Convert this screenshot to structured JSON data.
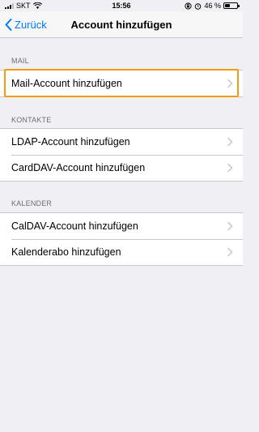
{
  "status_bar": {
    "carrier": "SKT",
    "time": "15:56",
    "battery_percent": "46 %",
    "battery_level": 0.46
  },
  "nav": {
    "back_label": "Zurück",
    "title": "Account hinzufügen"
  },
  "sections": [
    {
      "header": "MAIL",
      "rows": [
        "Mail-Account hinzufügen"
      ]
    },
    {
      "header": "KONTAKTE",
      "rows": [
        "LDAP-Account hinzufügen",
        "CardDAV-Account hinzufügen"
      ]
    },
    {
      "header": "KALENDER",
      "rows": [
        "CalDAV-Account hinzufügen",
        "Kalenderabo hinzufügen"
      ]
    }
  ],
  "colors": {
    "accent": "#007aff",
    "highlight": "#f39c12",
    "background": "#efeff4"
  }
}
